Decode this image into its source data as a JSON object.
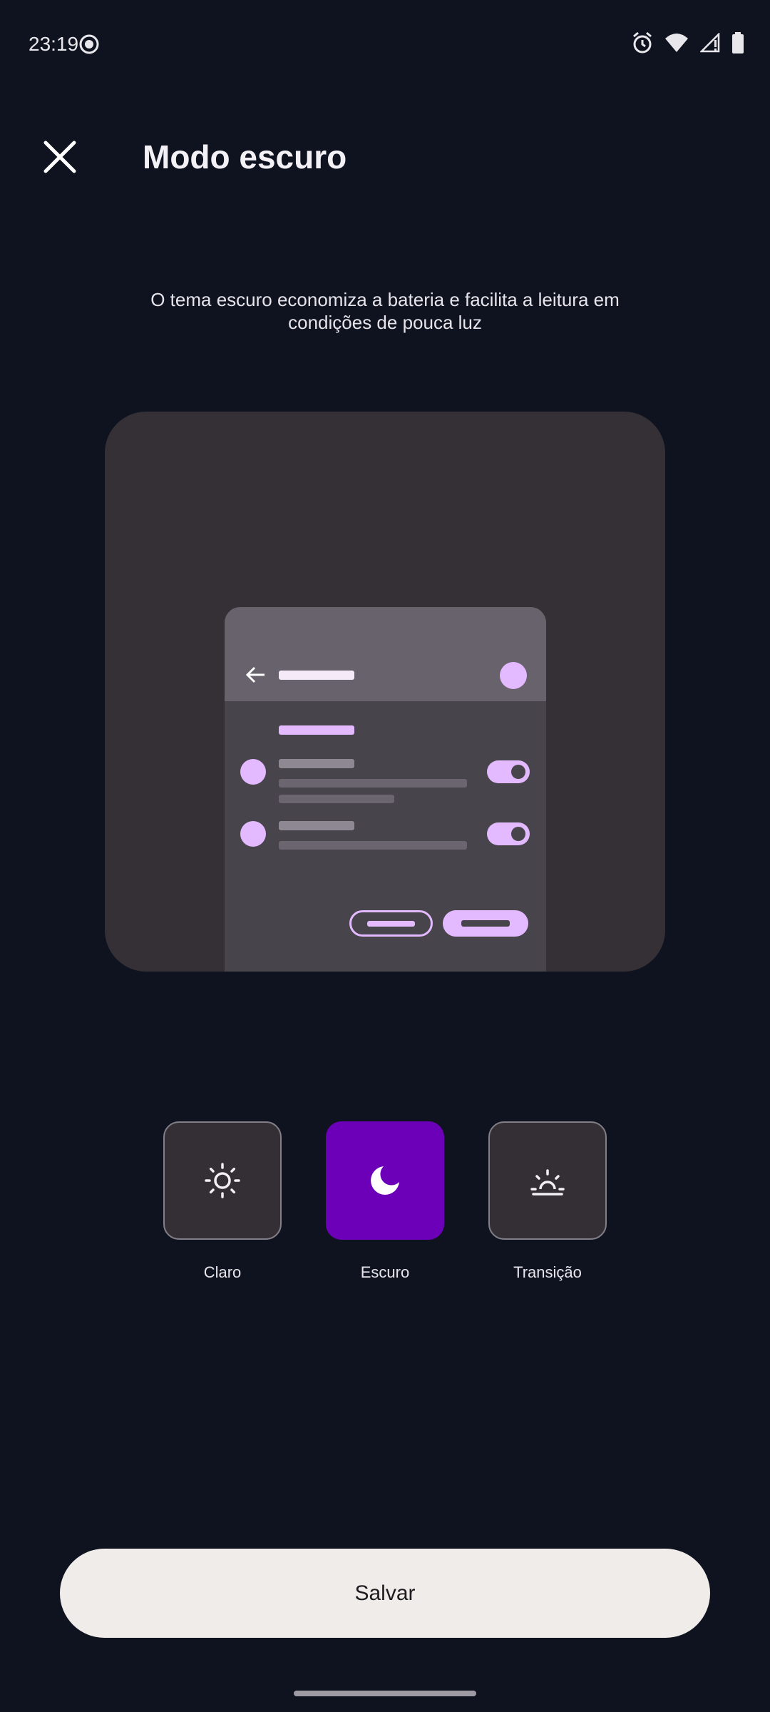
{
  "status_bar": {
    "time": "23:19",
    "icons": [
      "screen-record-icon",
      "alarm-icon",
      "wifi-icon",
      "cell-signal-icon",
      "battery-icon"
    ]
  },
  "header": {
    "close_icon": "close-icon",
    "title": "Modo escuro"
  },
  "description": "O tema escuro economiza a bateria e facilita a leitura em condições de pouca luz",
  "modes": [
    {
      "label": "Claro",
      "icon": "sun-icon",
      "selected": false
    },
    {
      "label": "Escuro",
      "icon": "moon-icon",
      "selected": true
    },
    {
      "label": "Transição",
      "icon": "sunrise-icon",
      "selected": false
    }
  ],
  "save_label": "Salvar",
  "colors": {
    "background": "#0f1320",
    "accent": "#6c00b8",
    "preview_accent": "#e3b9ff",
    "button": "#f0ece9"
  }
}
